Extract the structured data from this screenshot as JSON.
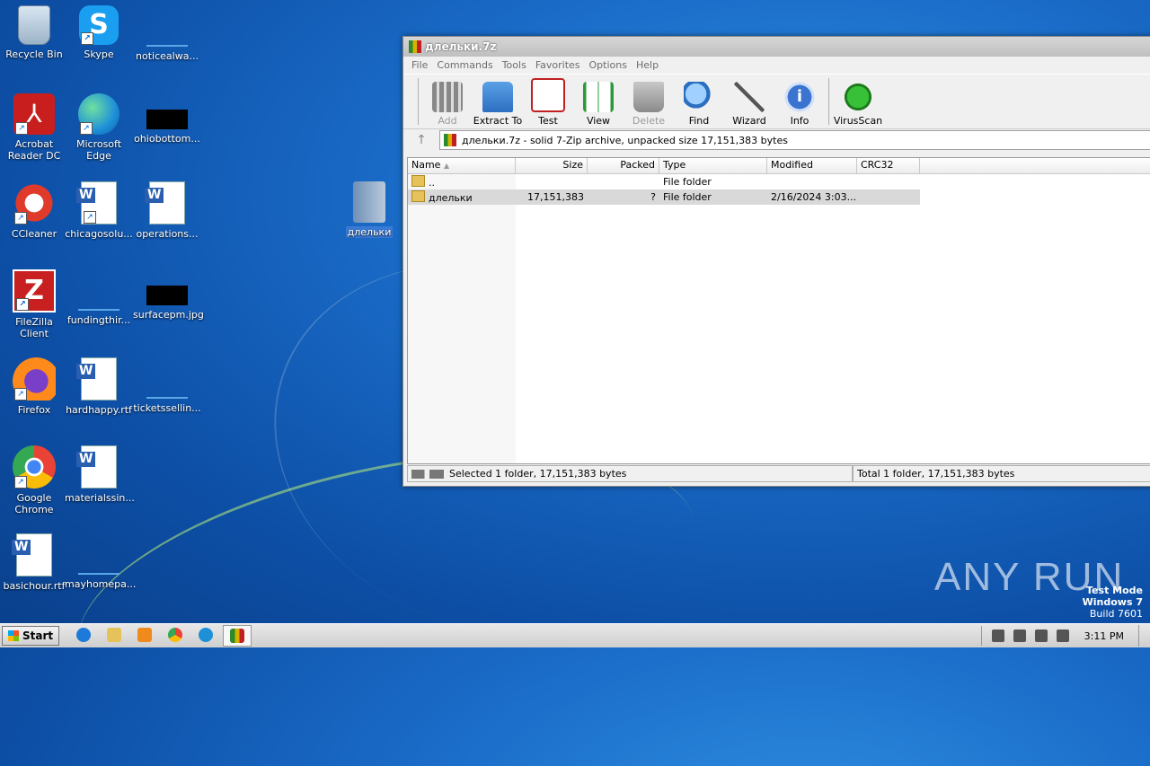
{
  "desktop": {
    "icons": [
      {
        "label": "Recycle Bin"
      },
      {
        "label": "Skype"
      },
      {
        "label": "noticealwa..."
      },
      {
        "label": "Acrobat Reader DC"
      },
      {
        "label": "Microsoft Edge"
      },
      {
        "label": "ohiobottom..."
      },
      {
        "label": "CCleaner"
      },
      {
        "label": "chicagosolu..."
      },
      {
        "label": "operations..."
      },
      {
        "label": "FileZilla Client"
      },
      {
        "label": "fundingthir..."
      },
      {
        "label": "surfacepm.jpg"
      },
      {
        "label": "Firefox"
      },
      {
        "label": "hardhappy.rtf"
      },
      {
        "label": "ticketssellin..."
      },
      {
        "label": "Google Chrome"
      },
      {
        "label": "materialssin..."
      },
      {
        "label": "basichour.rtf"
      },
      {
        "label": "mayhomepa..."
      },
      {
        "label": "длельки"
      }
    ]
  },
  "window": {
    "title": "длельки.7z",
    "menu": [
      "File",
      "Commands",
      "Tools",
      "Favorites",
      "Options",
      "Help"
    ],
    "toolbar": [
      {
        "label": "Add",
        "icon": "add-icon",
        "disabled": true
      },
      {
        "label": "Extract To",
        "icon": "extract-icon",
        "disabled": false
      },
      {
        "label": "Test",
        "icon": "test-icon",
        "disabled": false
      },
      {
        "label": "View",
        "icon": "view-icon",
        "disabled": false
      },
      {
        "label": "Delete",
        "icon": "delete-icon",
        "disabled": true
      },
      {
        "label": "Find",
        "icon": "find-icon",
        "disabled": false
      },
      {
        "label": "Wizard",
        "icon": "wizard-icon",
        "disabled": false
      },
      {
        "label": "Info",
        "icon": "info-icon",
        "disabled": false
      },
      {
        "label": "VirusScan",
        "icon": "virusscan-icon",
        "disabled": false
      }
    ],
    "address": "длельки.7z - solid 7-Zip archive, unpacked size 17,151,383 bytes",
    "columns": {
      "name": "Name",
      "size": "Size",
      "packed": "Packed",
      "type": "Type",
      "modified": "Modified",
      "crc": "CRC32"
    },
    "rows": [
      {
        "name": "..",
        "size": "",
        "packed": "",
        "type": "File folder",
        "modified": "",
        "crc": ""
      },
      {
        "name": "длельки",
        "size": "17,151,383",
        "packed": "?",
        "type": "File folder",
        "modified": "2/16/2024 3:03...",
        "crc": ""
      }
    ],
    "status_left": "Selected 1 folder, 17,151,383 bytes",
    "status_right": "Total 1 folder, 17,151,383 bytes"
  },
  "taskbar": {
    "start_label": "Start",
    "clock": "3:11 PM"
  },
  "watermark": {
    "line1": "Test Mode",
    "line2": "Windows 7",
    "line3": "Build 7601",
    "brand": "ANY RUN"
  }
}
